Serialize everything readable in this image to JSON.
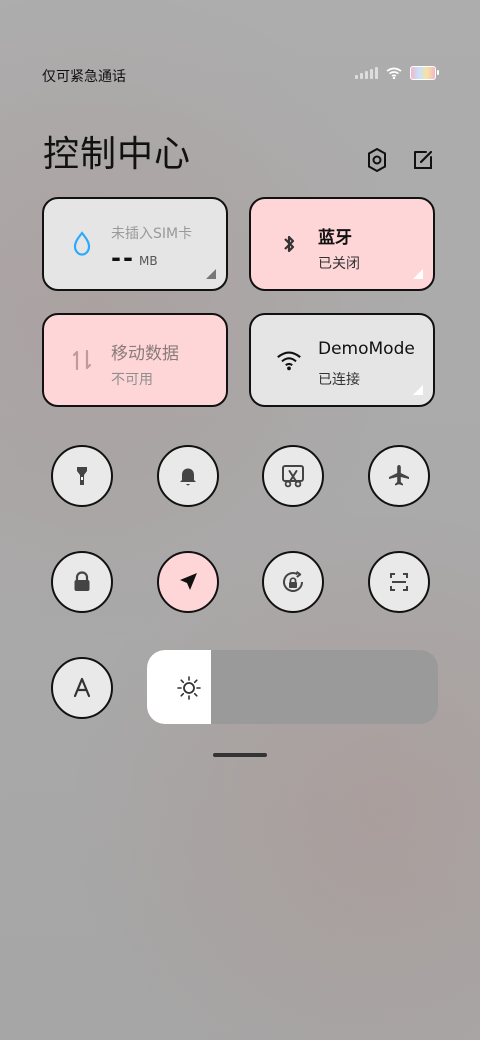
{
  "status": {
    "left_text": "仅可紧急通话"
  },
  "header": {
    "title": "控制中心"
  },
  "cards": {
    "sim": {
      "top": "未插入SIM卡",
      "middle": "--",
      "unit": "MB"
    },
    "bluetooth": {
      "title": "蓝牙",
      "status": "已关闭"
    },
    "mobile_data": {
      "title": "移动数据",
      "status": "不可用"
    },
    "wifi": {
      "title": "DemoMode",
      "status": "已连接"
    }
  },
  "icons": {
    "settings": "gear-icon",
    "edit": "edit-icon",
    "sim": "water-drop-icon",
    "bluetooth": "bluetooth-icon",
    "mobile_data": "data-transfer-icon",
    "wifi": "wifi-icon",
    "flashlight": "flashlight-icon",
    "bell": "bell-icon",
    "screenshot": "scissors-icon",
    "airplane": "airplane-icon",
    "lock": "lock-icon",
    "location": "location-arrow-icon",
    "rotate": "rotation-lock-icon",
    "scan": "scan-icon",
    "font": "font-size-icon",
    "brightness": "sun-icon"
  },
  "brightness": {
    "level_fraction": 0.22
  },
  "colors": {
    "pink_tile": "#ffd6d8",
    "gray_tile": "#e5e5e5",
    "accent_blue": "#2da8ff"
  }
}
